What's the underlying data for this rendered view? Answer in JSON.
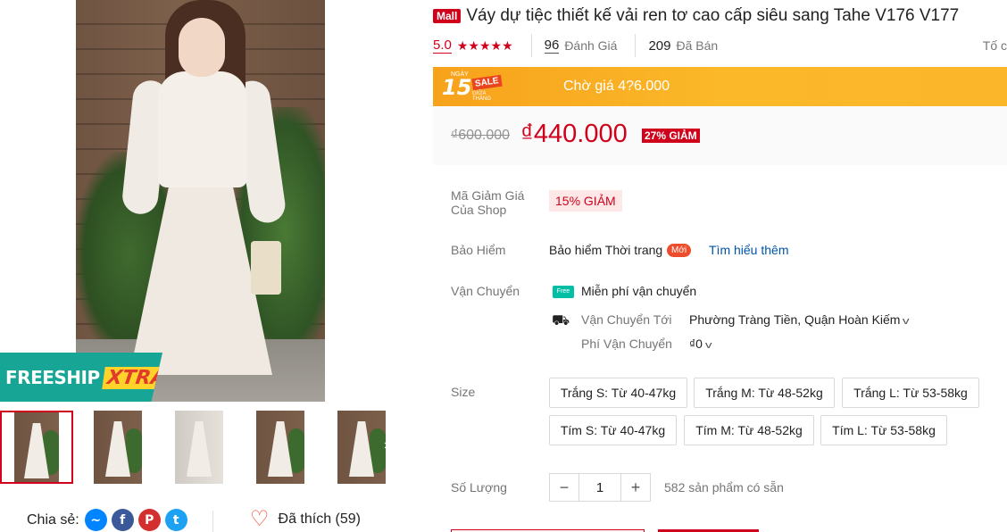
{
  "product": {
    "mall_badge": "Mall",
    "title": "Váy dự tiệc thiết kế vải ren tơ cao cấp siêu sang Tahe V176 V177"
  },
  "rating": {
    "value": "5.0",
    "stars": "★★★★★",
    "reviews_count": "96",
    "reviews_label": "Đánh Giá",
    "sold_count": "209",
    "sold_label": "Đã Bán",
    "report_label": "Tố c"
  },
  "flash_sale": {
    "logo_day": "15",
    "logo_ngay": "NGÀY",
    "logo_sale": "SALE",
    "logo_sub": "GIỮA THÁNG",
    "text": "Chờ giá 4?6.000"
  },
  "price": {
    "original": "₫600.000",
    "current": "₫440.000",
    "discount": "27% GIẢM"
  },
  "voucher": {
    "label": "Mã Giảm Giá Của Shop",
    "value": "15% GIẢM"
  },
  "insurance": {
    "label": "Bảo Hiểm",
    "text": "Bảo hiểm Thời trang",
    "badge": "Mới",
    "link": "Tìm hiểu thêm"
  },
  "shipping": {
    "label": "Vận Chuyển",
    "free_icon_text": "Free",
    "free_text": "Miễn phí vận chuyển",
    "to_label": "Vận Chuyển Tới",
    "to_value": "Phường Tràng Tiền, Quận Hoàn Kiếm",
    "fee_label": "Phí Vận Chuyển",
    "fee_value": "₫0"
  },
  "size": {
    "label": "Size",
    "options": [
      "Trắng S: Từ 40-47kg",
      "Trắng M: Từ 48-52kg",
      "Trắng L: Từ 53-58kg",
      "Tím S: Từ 40-47kg",
      "Tím M: Từ 48-52kg",
      "Tím L: Từ 53-58kg"
    ]
  },
  "quantity": {
    "label": "Số Lượng",
    "minus": "−",
    "value": "1",
    "plus": "+",
    "stock": "582 sản phẩm có sẵn"
  },
  "gallery": {
    "freeship_text": "FREESHIP",
    "freeship_xtra": "XTRA",
    "next_arrow": "›"
  },
  "share": {
    "label": "Chia sẻ:",
    "facebook_glyph": "f",
    "pinterest_glyph": "P",
    "twitter_glyph": "t",
    "messenger_glyph": "~"
  },
  "like": {
    "heart": "♡",
    "label": "Đã thích (59)"
  },
  "icons": {
    "truck": "⛟",
    "chevron": "v"
  },
  "colors": {
    "brand_red": "#d0011b",
    "flash_orange": "#f7a21b",
    "freeship_teal": "#17a595"
  }
}
